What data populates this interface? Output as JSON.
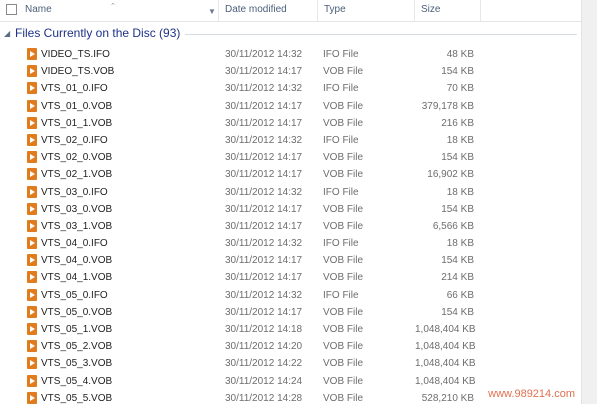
{
  "columns": {
    "name": "Name",
    "date": "Date modified",
    "type": "Type",
    "size": "Size"
  },
  "group": {
    "title": "Files Currently on the Disc (93)"
  },
  "files": [
    {
      "name": "VIDEO_TS.IFO",
      "date": "30/11/2012 14:32",
      "type": "IFO File",
      "size": "48 KB"
    },
    {
      "name": "VIDEO_TS.VOB",
      "date": "30/11/2012 14:17",
      "type": "VOB File",
      "size": "154 KB"
    },
    {
      "name": "VTS_01_0.IFO",
      "date": "30/11/2012 14:32",
      "type": "IFO File",
      "size": "70 KB"
    },
    {
      "name": "VTS_01_0.VOB",
      "date": "30/11/2012 14:17",
      "type": "VOB File",
      "size": "379,178 KB"
    },
    {
      "name": "VTS_01_1.VOB",
      "date": "30/11/2012 14:17",
      "type": "VOB File",
      "size": "216 KB"
    },
    {
      "name": "VTS_02_0.IFO",
      "date": "30/11/2012 14:32",
      "type": "IFO File",
      "size": "18 KB"
    },
    {
      "name": "VTS_02_0.VOB",
      "date": "30/11/2012 14:17",
      "type": "VOB File",
      "size": "154 KB"
    },
    {
      "name": "VTS_02_1.VOB",
      "date": "30/11/2012 14:17",
      "type": "VOB File",
      "size": "16,902 KB"
    },
    {
      "name": "VTS_03_0.IFO",
      "date": "30/11/2012 14:32",
      "type": "IFO File",
      "size": "18 KB"
    },
    {
      "name": "VTS_03_0.VOB",
      "date": "30/11/2012 14:17",
      "type": "VOB File",
      "size": "154 KB"
    },
    {
      "name": "VTS_03_1.VOB",
      "date": "30/11/2012 14:17",
      "type": "VOB File",
      "size": "6,566 KB"
    },
    {
      "name": "VTS_04_0.IFO",
      "date": "30/11/2012 14:32",
      "type": "IFO File",
      "size": "18 KB"
    },
    {
      "name": "VTS_04_0.VOB",
      "date": "30/11/2012 14:17",
      "type": "VOB File",
      "size": "154 KB"
    },
    {
      "name": "VTS_04_1.VOB",
      "date": "30/11/2012 14:17",
      "type": "VOB File",
      "size": "214 KB"
    },
    {
      "name": "VTS_05_0.IFO",
      "date": "30/11/2012 14:32",
      "type": "IFO File",
      "size": "66 KB"
    },
    {
      "name": "VTS_05_0.VOB",
      "date": "30/11/2012 14:17",
      "type": "VOB File",
      "size": "154 KB"
    },
    {
      "name": "VTS_05_1.VOB",
      "date": "30/11/2012 14:18",
      "type": "VOB File",
      "size": "1,048,404 KB"
    },
    {
      "name": "VTS_05_2.VOB",
      "date": "30/11/2012 14:20",
      "type": "VOB File",
      "size": "1,048,404 KB"
    },
    {
      "name": "VTS_05_3.VOB",
      "date": "30/11/2012 14:22",
      "type": "VOB File",
      "size": "1,048,404 KB"
    },
    {
      "name": "VTS_05_4.VOB",
      "date": "30/11/2012 14:24",
      "type": "VOB File",
      "size": "1,048,404 KB"
    },
    {
      "name": "VTS_05_5.VOB",
      "date": "30/11/2012 14:28",
      "type": "VOB File",
      "size": "528,210 KB"
    }
  ],
  "watermark": "www.989214.com"
}
